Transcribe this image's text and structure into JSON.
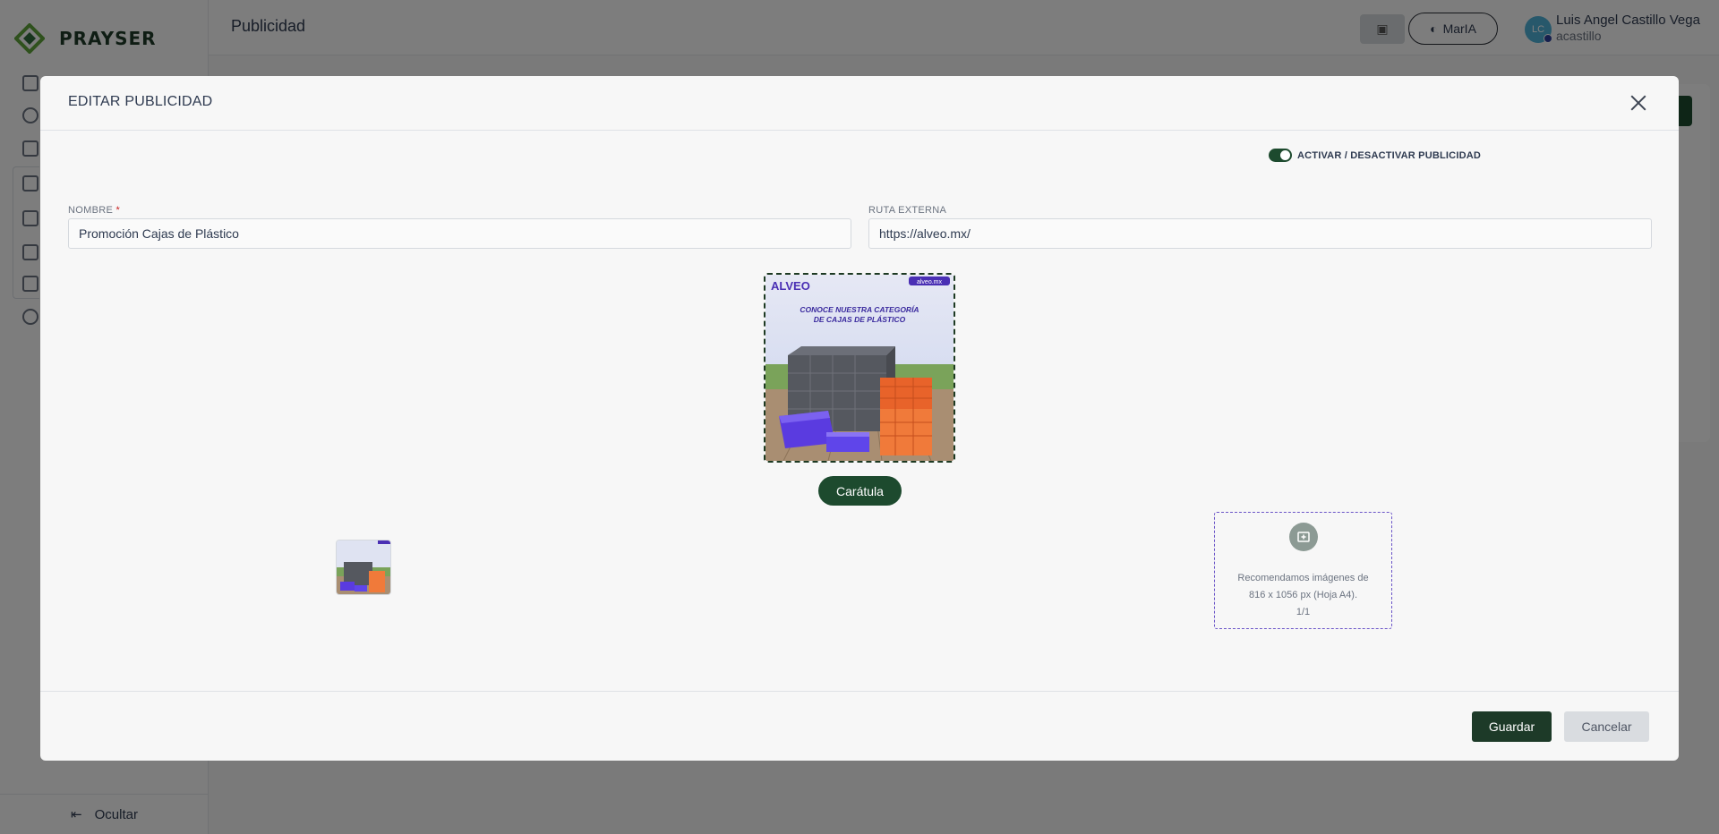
{
  "app": {
    "brand": "PRAYSER",
    "page_title": "Publicidad",
    "marla_label": "MarIA",
    "user": {
      "initials": "LC",
      "name": "Luis Angel Castillo Vega",
      "handle": "acastillo"
    },
    "sidebar_hide_label": "Ocultar"
  },
  "modal": {
    "title": "EDITAR PUBLICIDAD",
    "toggle": {
      "label": "ACTIVAR / DESACTIVAR PUBLICIDAD",
      "on": true
    },
    "fields": {
      "name": {
        "label": "NOMBRE",
        "required_mark": "*",
        "value": "Promoción Cajas de Plástico"
      },
      "external_route": {
        "label": "RUTA EXTERNA",
        "value": "https://alveo.mx/"
      }
    },
    "cover": {
      "brand": "ALVEO",
      "site": "alveo.mx",
      "headline_1": "CONOCE NUESTRA CATEGORÍA",
      "headline_2": "DE CAJAS DE PLÁSTICO",
      "button_label": "Carátula"
    },
    "upload": {
      "line1": "Recomendamos imágenes de",
      "line2": "816 x 1056 px (Hoja A4).",
      "count": "1/1"
    },
    "footer": {
      "save_label": "Guardar",
      "cancel_label": "Cancelar"
    }
  },
  "colors": {
    "primary": "#1d4a2e",
    "dark_primary": "#1d3a28",
    "upload_border": "#6b55c8"
  }
}
